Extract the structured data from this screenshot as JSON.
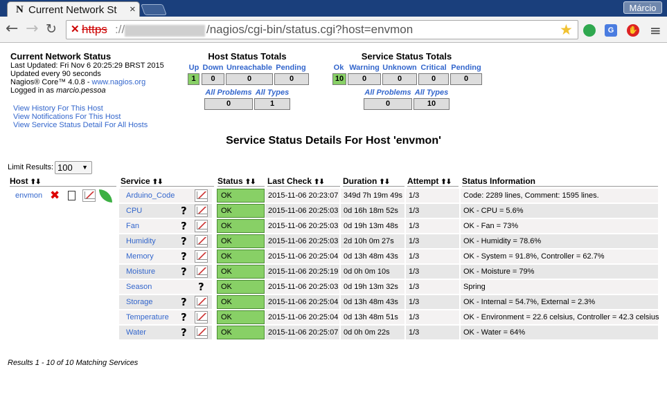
{
  "browser": {
    "tab_title": "Current Network Sta",
    "tab_logo": "N",
    "profile": "Márcio",
    "url_scheme": "https",
    "url_sep": "://",
    "url_path": "/nagios/cgi-bin/status.cgi?host=envmon"
  },
  "info": {
    "title": "Current Network Status",
    "last_updated": "Last Updated: Fri Nov 6 20:25:29 BRST 2015",
    "update_interval": "Updated every 90 seconds",
    "core_prefix": "Nagios® Core™ 4.0.8 - ",
    "core_link": "www.nagios.org",
    "logged_prefix": "Logged in as ",
    "user": "marcio.pessoa"
  },
  "links": [
    "View History For This Host",
    "View Notifications For This Host",
    "View Service Status Detail For All Hosts"
  ],
  "host_totals": {
    "title": "Host Status Totals",
    "headers": [
      "Up",
      "Down",
      "Unreachable",
      "Pending"
    ],
    "values": [
      "1",
      "0",
      "0",
      "0"
    ],
    "all_problems": "All Problems",
    "all_types": "All Types",
    "problems_value": "0",
    "types_value": "1"
  },
  "service_totals": {
    "title": "Service Status Totals",
    "headers": [
      "Ok",
      "Warning",
      "Unknown",
      "Critical",
      "Pending"
    ],
    "values": [
      "10",
      "0",
      "0",
      "0",
      "0"
    ],
    "all_problems": "All Problems",
    "all_types": "All Types",
    "problems_value": "0",
    "types_value": "10"
  },
  "section_title": "Service Status Details For Host 'envmon'",
  "limit": {
    "label": "Limit Results:",
    "value": "100"
  },
  "columns": [
    "Host",
    "Service",
    "Status",
    "Last Check",
    "Duration",
    "Attempt",
    "Status Information"
  ],
  "host": "envmon",
  "services": [
    {
      "name": "Arduino_Code",
      "status": "OK",
      "last_check": "2015-11-06 20:23:07",
      "duration": "349d 7h 19m 49s",
      "attempt": "1/3",
      "info": "Code: 2289 lines, Comment: 1595 lines."
    },
    {
      "name": "CPU",
      "status": "OK",
      "last_check": "2015-11-06 20:25:03",
      "duration": "0d 16h 18m 52s",
      "attempt": "1/3",
      "info": "OK - CPU = 5.6%"
    },
    {
      "name": "Fan",
      "status": "OK",
      "last_check": "2015-11-06 20:25:03",
      "duration": "0d 19h 13m 48s",
      "attempt": "1/3",
      "info": "OK - Fan = 73%"
    },
    {
      "name": "Humidity",
      "status": "OK",
      "last_check": "2015-11-06 20:25:03",
      "duration": "2d 10h 0m 27s",
      "attempt": "1/3",
      "info": "OK - Humidity = 78.6%"
    },
    {
      "name": "Memory",
      "status": "OK",
      "last_check": "2015-11-06 20:25:04",
      "duration": "0d 13h 48m 43s",
      "attempt": "1/3",
      "info": "OK - System = 91.8%, Controller = 62.7%"
    },
    {
      "name": "Moisture",
      "status": "OK",
      "last_check": "2015-11-06 20:25:19",
      "duration": "0d 0h 0m 10s",
      "attempt": "1/3",
      "info": "OK - Moisture = 79%"
    },
    {
      "name": "Season",
      "status": "OK",
      "last_check": "2015-11-06 20:25:03",
      "duration": "0d 19h 13m 32s",
      "attempt": "1/3",
      "info": "Spring"
    },
    {
      "name": "Storage",
      "status": "OK",
      "last_check": "2015-11-06 20:25:04",
      "duration": "0d 13h 48m 43s",
      "attempt": "1/3",
      "info": "OK - Internal = 54.7%, External = 2.3%"
    },
    {
      "name": "Temperature",
      "status": "OK",
      "last_check": "2015-11-06 20:25:04",
      "duration": "0d 13h 48m 51s",
      "attempt": "1/3",
      "info": "OK - Environment = 22.6 celsius, Controller = 42.3 celsius"
    },
    {
      "name": "Water",
      "status": "OK",
      "last_check": "2015-11-06 20:25:07",
      "duration": "0d 0h 0m 22s",
      "attempt": "1/3",
      "info": "OK - Water = 64%"
    }
  ],
  "footer": "Results 1 - 10 of 10 Matching Services",
  "colors": {
    "ok": "#88d066",
    "link": "#3366cc",
    "row_even": "#f4f2f2",
    "row_odd": "#e7e7e7"
  }
}
